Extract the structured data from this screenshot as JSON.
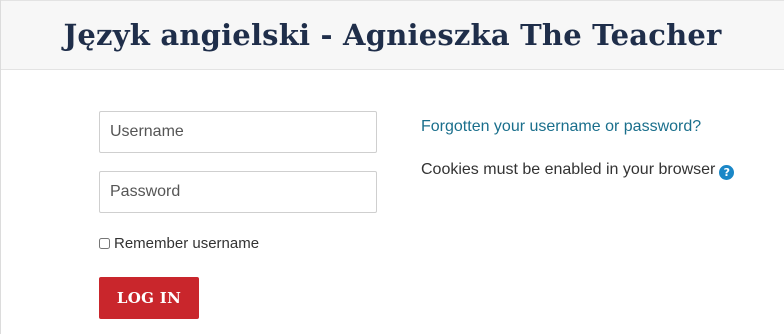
{
  "header": {
    "title": "Język angielski - Agnieszka The Teacher"
  },
  "login": {
    "username_placeholder": "Username",
    "username_value": "",
    "password_placeholder": "Password",
    "password_value": "",
    "remember_label": "Remember username",
    "remember_checked": false,
    "submit_label": "LOG IN"
  },
  "info": {
    "forgot_link": "Forgotten your username or password?",
    "cookies_text": "Cookies must be enabled in your browser",
    "help_icon": "question-circle-icon",
    "help_glyph": "?"
  },
  "colors": {
    "title": "#1f2e4a",
    "button": "#c9262c",
    "link": "#1a6f8c",
    "help_icon": "#1a87c7"
  }
}
